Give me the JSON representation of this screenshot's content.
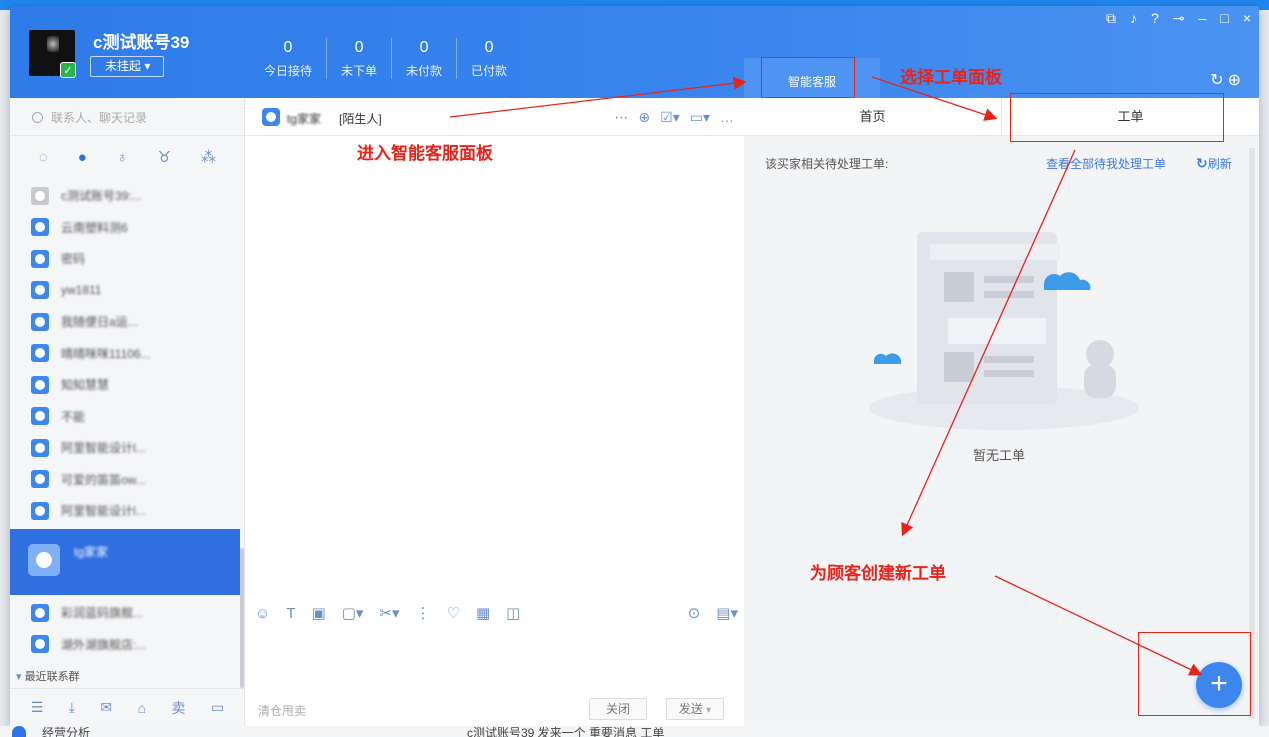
{
  "header": {
    "account_name": "c测试账号39",
    "status_label": "未挂起",
    "stats": [
      {
        "value": "0",
        "label": "今日接待"
      },
      {
        "value": "0",
        "label": "未下单"
      },
      {
        "value": "0",
        "label": "未付款"
      },
      {
        "value": "0",
        "label": "已付款"
      }
    ],
    "smart_tab_label": "智能客服"
  },
  "left": {
    "search_placeholder": "联系人、聊天记录",
    "contacts": [
      {
        "name": "c测试账号39:..."
      },
      {
        "name": "云南塑料测6"
      },
      {
        "name": "密码"
      },
      {
        "name": "yw1811"
      },
      {
        "name": "我随便日a运..."
      },
      {
        "name": "晴晴咪咪11106..."
      },
      {
        "name": "知知慧慧"
      },
      {
        "name": "不能"
      },
      {
        "name": "阿里智能设计l..."
      },
      {
        "name": "可爱的笛笛ow..."
      },
      {
        "name": "阿里智能设计l..."
      }
    ],
    "active_contact": "tg家家",
    "contacts_after": [
      {
        "name": "彩润蓝码旗舰..."
      },
      {
        "name": "湖外湖旗舰店:..."
      }
    ],
    "group_title": "最近联系群"
  },
  "chat": {
    "contact_name": "tg家家",
    "contact_tag": "[陌生人]",
    "input_hint": "清仓甩卖",
    "close_label": "关闭",
    "send_label": "发送"
  },
  "right": {
    "tabs": [
      "首页",
      "工单"
    ],
    "pending_hint": "该买家相关待处理工单:",
    "view_all_link": "查看全部待我处理工单",
    "refresh_label": "刷新",
    "empty_text": "暂无工单",
    "fab_symbol": "+"
  },
  "annotations": {
    "enter_panel": "进入智能客服面板",
    "select_panel": "选择工单面板",
    "create_order": "为顾客创建新工单"
  },
  "bottom": {
    "app_label": "经营分析",
    "notice": "c测试账号39 发来一个 重要消息 工单"
  },
  "colors": {
    "brand": "#2f7be8",
    "active": "#2f6fe0",
    "annotation": "#e8231a"
  }
}
